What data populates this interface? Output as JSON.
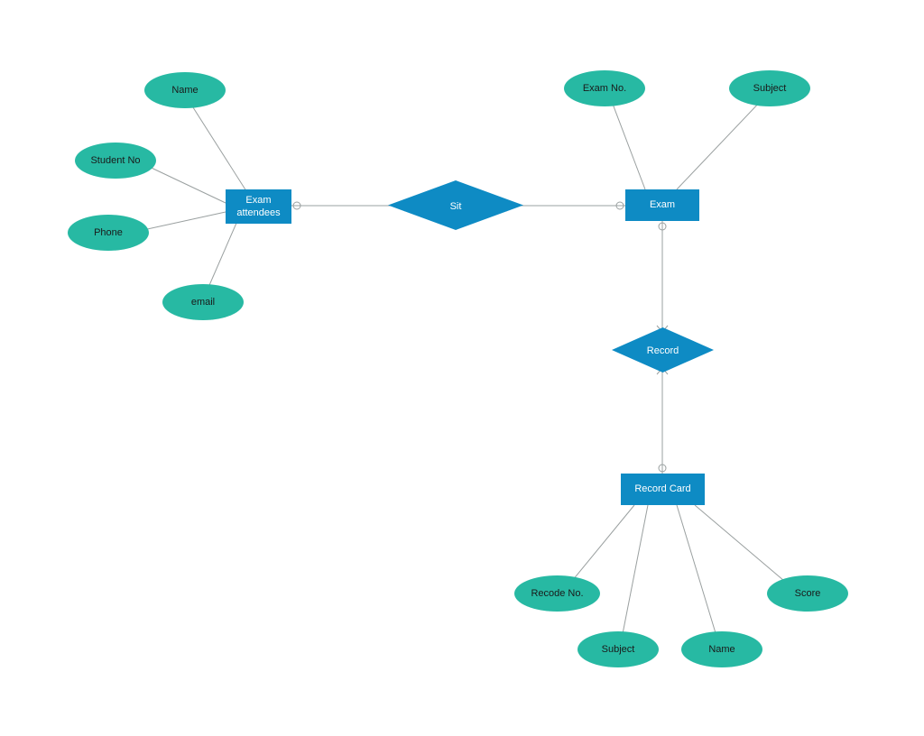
{
  "entities": {
    "examAttendees": "Exam\nattendees",
    "exam": "Exam",
    "recordCard": "Record Card"
  },
  "relationships": {
    "sit": "Sit",
    "record": "Record"
  },
  "attributes": {
    "name": "Name",
    "studentNo": "Student No",
    "phone": "Phone",
    "email": "email",
    "examNo": "Exam No.",
    "subject": "Subject",
    "recodeNo": "Recode No.",
    "rcSubject": "Subject",
    "rcName": "Name",
    "score": "Score"
  },
  "colors": {
    "entity": "#0e8bc4",
    "attribute": "#27b9a3",
    "connector": "#9aa0a0"
  }
}
